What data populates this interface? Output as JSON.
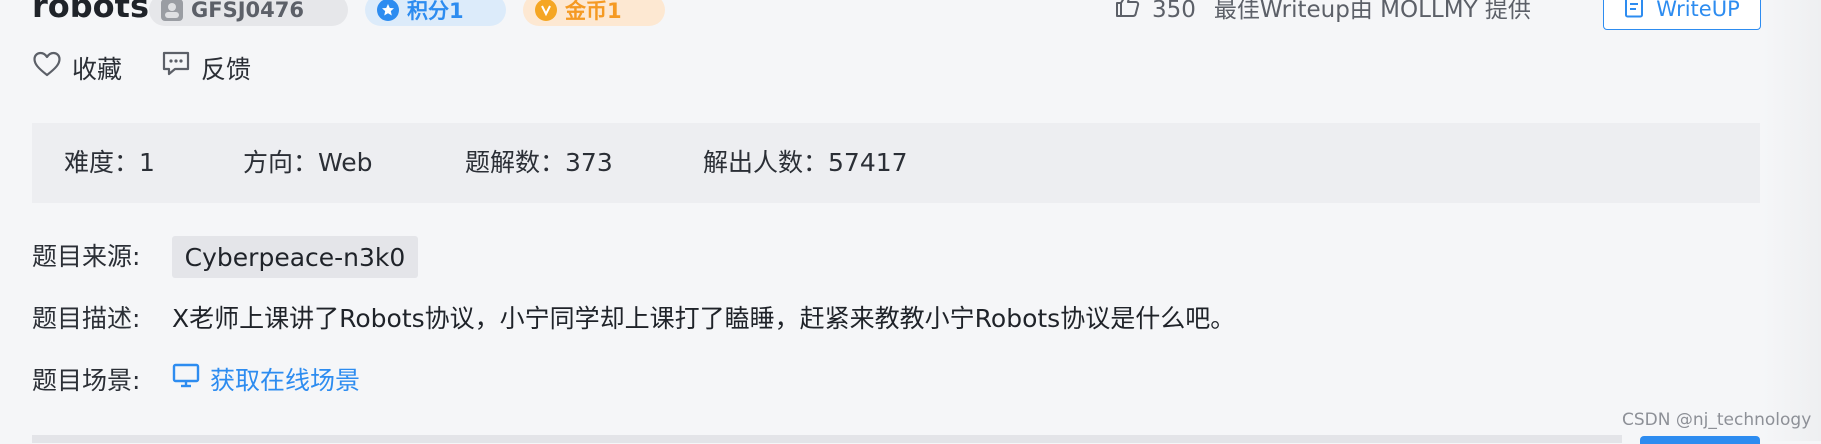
{
  "challenge": {
    "title": "robots",
    "author_label": "GFSJ0476",
    "score_label": "积分1",
    "coin_label": "金币1"
  },
  "header_right": {
    "likes": "350",
    "best_writeup_text": "最佳Writeup由 MOLLMY 提供",
    "writeup_button_label": "WriteUP"
  },
  "actions": {
    "favorite_label": "收藏",
    "feedback_label": "反馈"
  },
  "stats": [
    {
      "label": "难度：",
      "value": "1"
    },
    {
      "label": "方向：",
      "value": "Web"
    },
    {
      "label": "题解数：",
      "value": "373"
    },
    {
      "label": "解出人数：",
      "value": "57417"
    }
  ],
  "info": {
    "source_label": "题目来源:",
    "source_value": "Cyberpeace-n3k0",
    "description_label": "题目描述:",
    "description_value": "X老师上课讲了Robots协议，小宁同学却上课打了瞌睡，赶紧来教教小宁Robots协议是什么吧。",
    "scene_label": "题目场景:",
    "scene_link_label": "获取在线场景"
  },
  "watermark": "CSDN @nj_technology",
  "colors": {
    "accent": "#2d8cf0",
    "coin": "#f59a23",
    "panel": "#edeef1",
    "background": "#f5f6f8"
  },
  "icons": [
    "avatar-icon",
    "star-badge-icon",
    "coin-icon",
    "thumb-up-icon",
    "document-icon",
    "heart-icon",
    "comment-icon",
    "monitor-icon"
  ]
}
